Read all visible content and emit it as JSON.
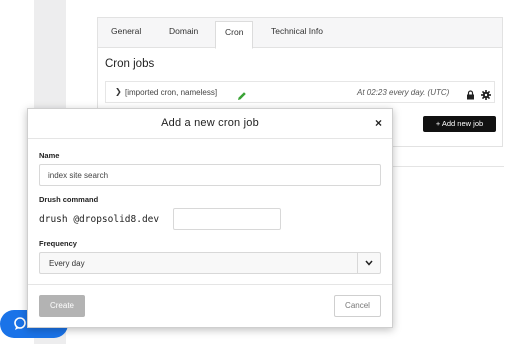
{
  "tabs": [
    {
      "label": "General"
    },
    {
      "label": "Domain"
    },
    {
      "label": "Cron"
    },
    {
      "label": "Technical Info"
    }
  ],
  "cron_panel": {
    "title": "Cron jobs",
    "jobs": [
      {
        "name": "[imported cron, nameless]",
        "schedule": "At 02:23 every day. (UTC)"
      }
    ],
    "add_button_label": "+ Add new job"
  },
  "modal": {
    "title": "Add a new cron job",
    "close_label": "×",
    "name_label": "Name",
    "name_value": "index site search",
    "drush_label": "Drush command",
    "drush_prefix": "drush @dropsolid8.dev",
    "drush_value": "",
    "frequency_label": "Frequency",
    "frequency_value": "Every day",
    "create_label": "Create",
    "cancel_label": "Cancel"
  },
  "colors": {
    "accent_black": "#111111",
    "chat_blue": "#1a73e8",
    "pencil_green": "#3aa335",
    "disabled_gray": "#b3b3b3"
  }
}
